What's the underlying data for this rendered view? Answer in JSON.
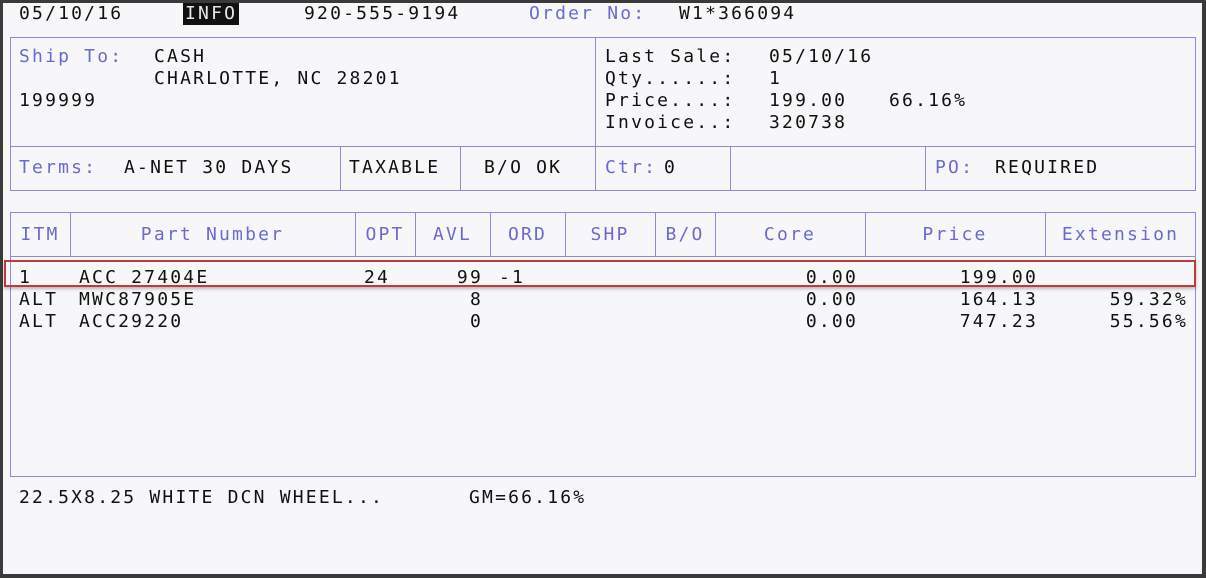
{
  "topbar": {
    "date": "05/10/16",
    "mode": "INFO",
    "phone": "920-555-9194",
    "order_label": "Order No:",
    "order_value": "W1*366094"
  },
  "ship": {
    "label": "Ship To:",
    "name": "CASH",
    "city": "CHARLOTTE, NC 28201",
    "account": "199999"
  },
  "last_sale": {
    "date_label": "Last Sale:",
    "date": "05/10/16",
    "qty_label": "Qty......:",
    "qty": "1",
    "price_label": "Price....:",
    "price": "199.00",
    "margin": "66.16%",
    "invoice_label": "Invoice..:",
    "invoice": "320738"
  },
  "terms": {
    "label": "Terms:",
    "value": "A-NET 30 DAYS",
    "taxable": "TAXABLE",
    "bo": "B/O OK",
    "ctr_label": "Ctr:",
    "ctr": "0",
    "po_label": "PO:",
    "po": "REQUIRED"
  },
  "table": {
    "headers": [
      "ITM",
      "Part Number",
      "OPT",
      "AVL",
      "ORD",
      "SHP",
      "B/O",
      "Core",
      "Price",
      "Extension"
    ],
    "rows": [
      {
        "itm": "1",
        "part": "ACC 27404E",
        "opt": "24",
        "avl": "99",
        "ord": "-1",
        "core": "0.00",
        "price": "199.00",
        "ext": ""
      },
      {
        "itm": "ALT",
        "part": "MWC87905E",
        "opt": "",
        "avl": "8",
        "ord": "",
        "core": "0.00",
        "price": "164.13",
        "ext": "59.32%"
      },
      {
        "itm": "ALT",
        "part": "ACC29220",
        "opt": "",
        "avl": "0",
        "ord": "",
        "core": "0.00",
        "price": "747.23",
        "ext": "55.56%"
      }
    ]
  },
  "footer": {
    "description": "22.5X8.25 WHITE DCN WHEEL...",
    "gm": "GM=66.16%"
  }
}
